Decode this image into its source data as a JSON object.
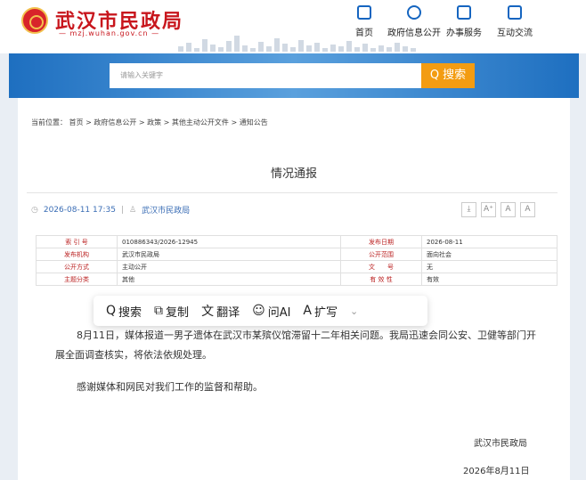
{
  "header": {
    "title": "武汉市民政局",
    "subtitle": "— mzj.wuhan.gov.cn —",
    "nav": [
      {
        "label": "首页",
        "icon": "home-icon"
      },
      {
        "label": "政府信息公开",
        "icon": "chat-icon"
      },
      {
        "label": "办事服务",
        "icon": "bookmark-icon"
      },
      {
        "label": "互动交流",
        "icon": "document-icon"
      }
    ]
  },
  "search": {
    "placeholder": "请输入关键字",
    "button_label": "Q 搜索"
  },
  "breadcrumb": "当前位置： 首页 > 政府信息公开 > 政策 > 其他主动公开文件 > 通知公告",
  "article": {
    "title": "情况通报",
    "datetime": "2026-08-11 17:35",
    "source": "武汉市民政局",
    "font_controls": [
      "⤓",
      "A⁺",
      "A",
      "A"
    ]
  },
  "info_table": [
    [
      "索 引 号",
      "010886343/2026-12945",
      "发布日期",
      "2026-08-11"
    ],
    [
      "发布机构",
      "武汉市民政局",
      "公开范围",
      "面向社会"
    ],
    [
      "公开方式",
      "主动公开",
      "文　　号",
      "无"
    ],
    [
      "主题分类",
      "其他",
      "有 效 性",
      "有效"
    ]
  ],
  "toolbar": {
    "search": "搜索",
    "copy": "复制",
    "translate": "翻译",
    "ask_ai": "问AI",
    "expand": "扩写"
  },
  "body": {
    "p1": "8月11日，媒体报道一男子遗体在武汉市某殡仪馆滞留十二年相关问题。我局迅速会同公安、卫健等部门开展全面调查核实，将依法依规处理。",
    "p2": "感谢媒体和网民对我们工作的监督和帮助。",
    "signature": "武汉市民政局",
    "date": "2026年8月11日"
  }
}
